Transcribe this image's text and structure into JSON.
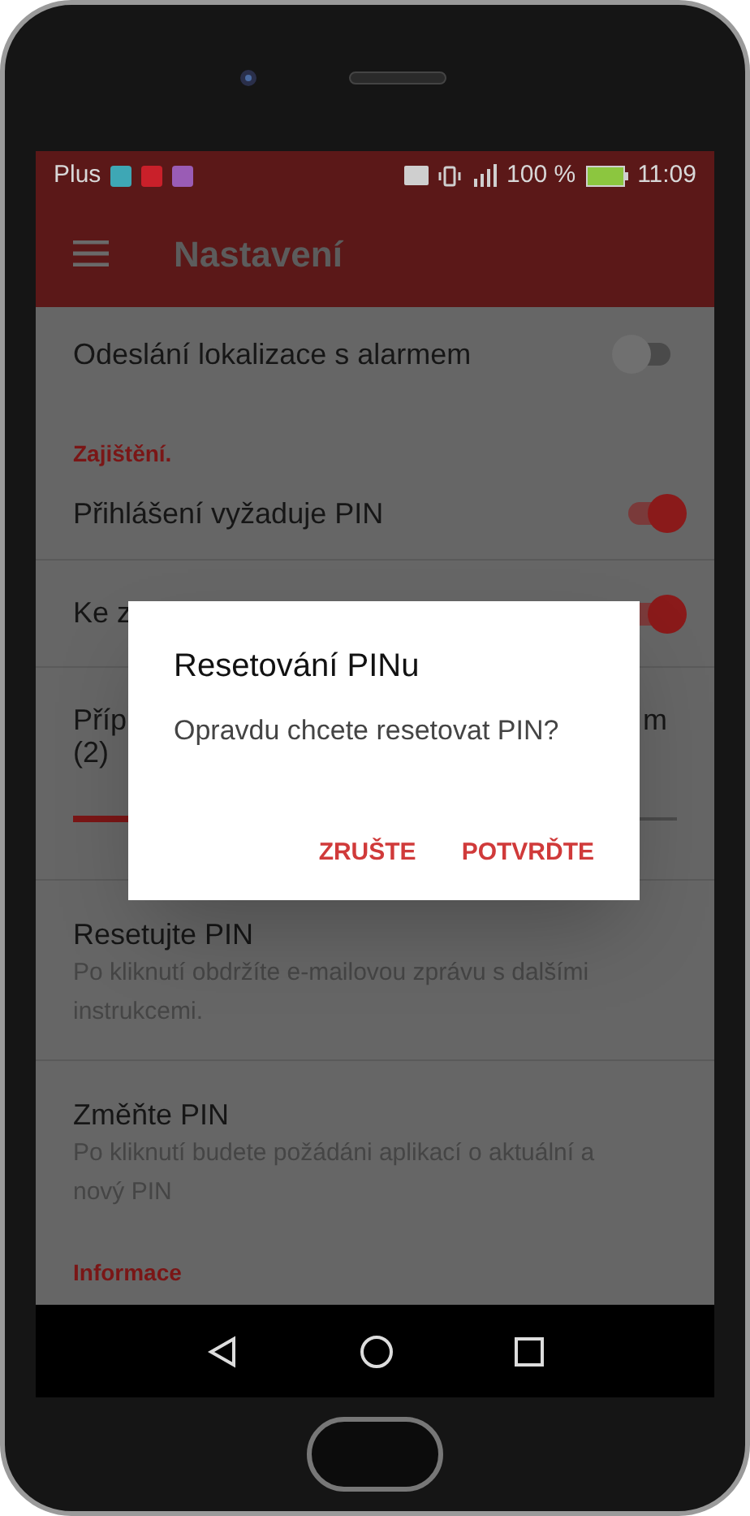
{
  "status_bar": {
    "carrier": "Plus",
    "battery": "100 %",
    "time": "11:09"
  },
  "app_bar": {
    "title": "Nastavení"
  },
  "settings": [
    {
      "kind": "switch",
      "label": "Odeslání lokalizace s alarmem",
      "on": false
    },
    {
      "kind": "header",
      "label": "Zajištění."
    },
    {
      "kind": "switch",
      "label": "Přihlášení vyžaduje PIN",
      "on": true
    },
    {
      "kind": "switch",
      "label": "Ke z",
      "on": true
    },
    {
      "kind": "slider",
      "label": "Příp",
      "label_end": "m",
      "label_line_2": "(2)",
      "level": 0.15
    },
    {
      "kind": "action",
      "label": "Resetujte PIN",
      "summary": "Po kliknutí obdržíte e-mailovou zprávu s dalšími instrukcemi."
    },
    {
      "kind": "action",
      "label": "Změňte PIN",
      "summary": "Po kliknutí budete požádáni aplikací o aktuální a nový PIN"
    },
    {
      "kind": "header",
      "label": "Informace"
    }
  ],
  "dialog": {
    "title": "Resetování PINu",
    "message": "Opravdu chcete resetovat PIN?",
    "buttons": [
      "ZRUŠTE",
      "POTVRĎTE"
    ]
  }
}
